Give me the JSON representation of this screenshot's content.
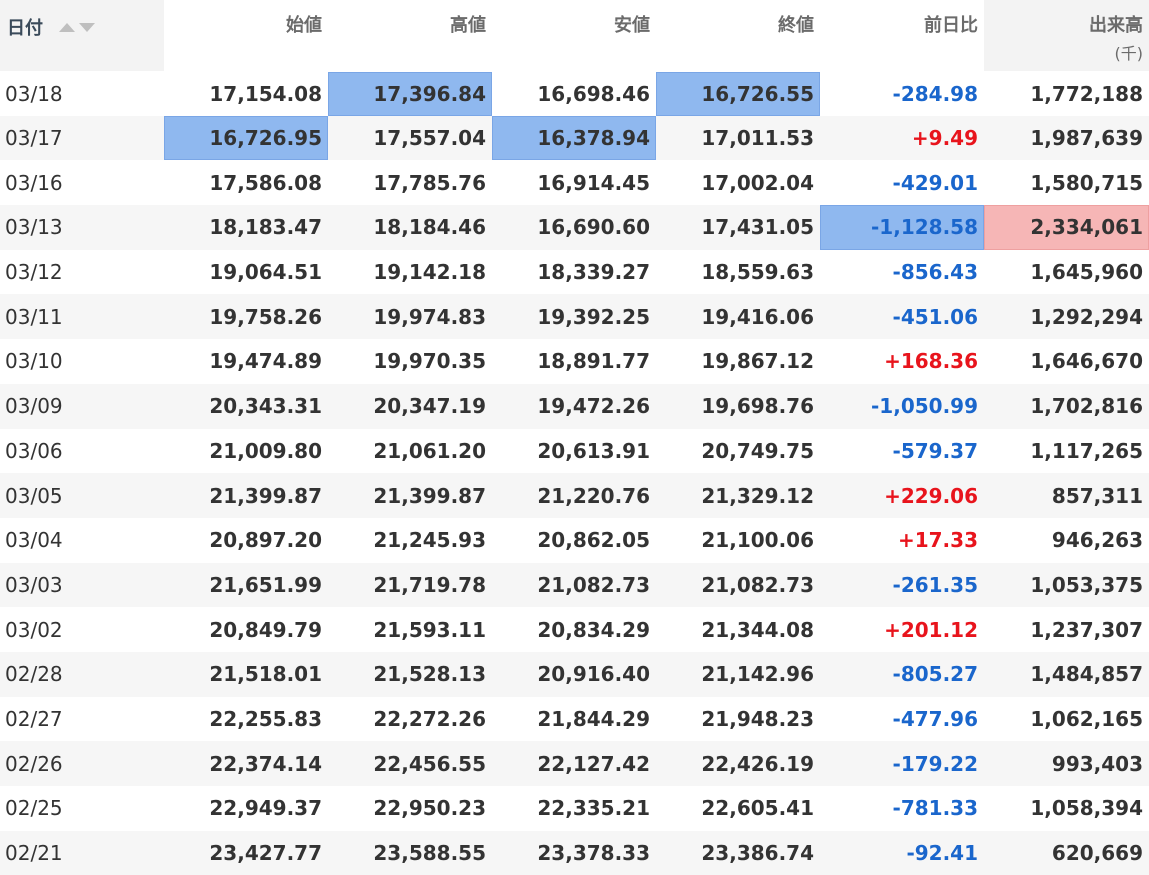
{
  "headers": {
    "date": "日付",
    "open": "始値",
    "high": "高値",
    "low": "安値",
    "close": "終値",
    "change": "前日比",
    "volume": "出来高",
    "volume_unit": "(千)"
  },
  "colors": {
    "negative": "#1a66cc",
    "positive": "#e8141c",
    "highlight_blue": "#8fb8ef",
    "highlight_red": "#f6b6b6"
  },
  "rows": [
    {
      "date": "03/18",
      "open": "17,154.08",
      "high": "17,396.84",
      "low": "16,698.46",
      "close": "16,726.55",
      "change": "-284.98",
      "volume": "1,772,188",
      "hl": {
        "high": "blue",
        "close": "blue"
      }
    },
    {
      "date": "03/17",
      "open": "16,726.95",
      "high": "17,557.04",
      "low": "16,378.94",
      "close": "17,011.53",
      "change": "+9.49",
      "volume": "1,987,639",
      "hl": {
        "open": "blue",
        "low": "blue"
      }
    },
    {
      "date": "03/16",
      "open": "17,586.08",
      "high": "17,785.76",
      "low": "16,914.45",
      "close": "17,002.04",
      "change": "-429.01",
      "volume": "1,580,715",
      "hl": {}
    },
    {
      "date": "03/13",
      "open": "18,183.47",
      "high": "18,184.46",
      "low": "16,690.60",
      "close": "17,431.05",
      "change": "-1,128.58",
      "volume": "2,334,061",
      "hl": {
        "change": "blue",
        "volume": "red"
      }
    },
    {
      "date": "03/12",
      "open": "19,064.51",
      "high": "19,142.18",
      "low": "18,339.27",
      "close": "18,559.63",
      "change": "-856.43",
      "volume": "1,645,960",
      "hl": {}
    },
    {
      "date": "03/11",
      "open": "19,758.26",
      "high": "19,974.83",
      "low": "19,392.25",
      "close": "19,416.06",
      "change": "-451.06",
      "volume": "1,292,294",
      "hl": {}
    },
    {
      "date": "03/10",
      "open": "19,474.89",
      "high": "19,970.35",
      "low": "18,891.77",
      "close": "19,867.12",
      "change": "+168.36",
      "volume": "1,646,670",
      "hl": {}
    },
    {
      "date": "03/09",
      "open": "20,343.31",
      "high": "20,347.19",
      "low": "19,472.26",
      "close": "19,698.76",
      "change": "-1,050.99",
      "volume": "1,702,816",
      "hl": {}
    },
    {
      "date": "03/06",
      "open": "21,009.80",
      "high": "21,061.20",
      "low": "20,613.91",
      "close": "20,749.75",
      "change": "-579.37",
      "volume": "1,117,265",
      "hl": {}
    },
    {
      "date": "03/05",
      "open": "21,399.87",
      "high": "21,399.87",
      "low": "21,220.76",
      "close": "21,329.12",
      "change": "+229.06",
      "volume": "857,311",
      "hl": {}
    },
    {
      "date": "03/04",
      "open": "20,897.20",
      "high": "21,245.93",
      "low": "20,862.05",
      "close": "21,100.06",
      "change": "+17.33",
      "volume": "946,263",
      "hl": {}
    },
    {
      "date": "03/03",
      "open": "21,651.99",
      "high": "21,719.78",
      "low": "21,082.73",
      "close": "21,082.73",
      "change": "-261.35",
      "volume": "1,053,375",
      "hl": {}
    },
    {
      "date": "03/02",
      "open": "20,849.79",
      "high": "21,593.11",
      "low": "20,834.29",
      "close": "21,344.08",
      "change": "+201.12",
      "volume": "1,237,307",
      "hl": {}
    },
    {
      "date": "02/28",
      "open": "21,518.01",
      "high": "21,528.13",
      "low": "20,916.40",
      "close": "21,142.96",
      "change": "-805.27",
      "volume": "1,484,857",
      "hl": {}
    },
    {
      "date": "02/27",
      "open": "22,255.83",
      "high": "22,272.26",
      "low": "21,844.29",
      "close": "21,948.23",
      "change": "-477.96",
      "volume": "1,062,165",
      "hl": {}
    },
    {
      "date": "02/26",
      "open": "22,374.14",
      "high": "22,456.55",
      "low": "22,127.42",
      "close": "22,426.19",
      "change": "-179.22",
      "volume": "993,403",
      "hl": {}
    },
    {
      "date": "02/25",
      "open": "22,949.37",
      "high": "22,950.23",
      "low": "22,335.21",
      "close": "22,605.41",
      "change": "-781.33",
      "volume": "1,058,394",
      "hl": {}
    },
    {
      "date": "02/21",
      "open": "23,427.77",
      "high": "23,588.55",
      "low": "23,378.33",
      "close": "23,386.74",
      "change": "-92.41",
      "volume": "620,669",
      "hl": {}
    }
  ]
}
